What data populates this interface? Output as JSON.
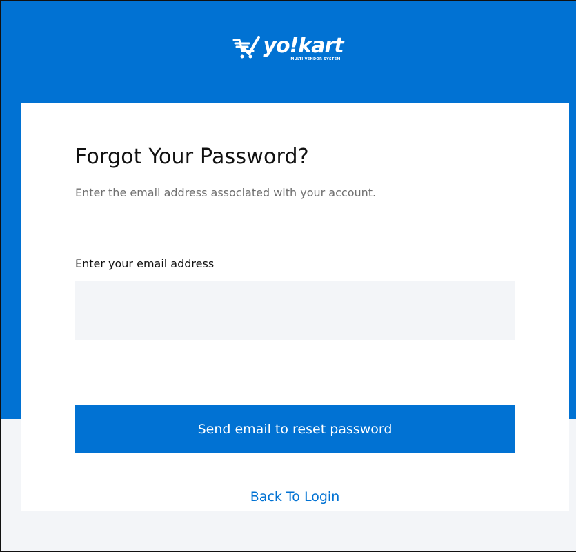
{
  "brand": {
    "name": "yo!kart",
    "tagline": "MULTI VENDOR SYSTEM",
    "logo_icon": "shopping-cart-checkmark-icon",
    "primary_color": "#0172d3"
  },
  "form": {
    "title": "Forgot Your Password?",
    "subtitle": "Enter the email address associated with your account.",
    "email_label": "Enter your email address",
    "email_value": "",
    "email_placeholder": "",
    "submit_label": "Send email to reset password",
    "back_link_label": "Back To Login"
  }
}
